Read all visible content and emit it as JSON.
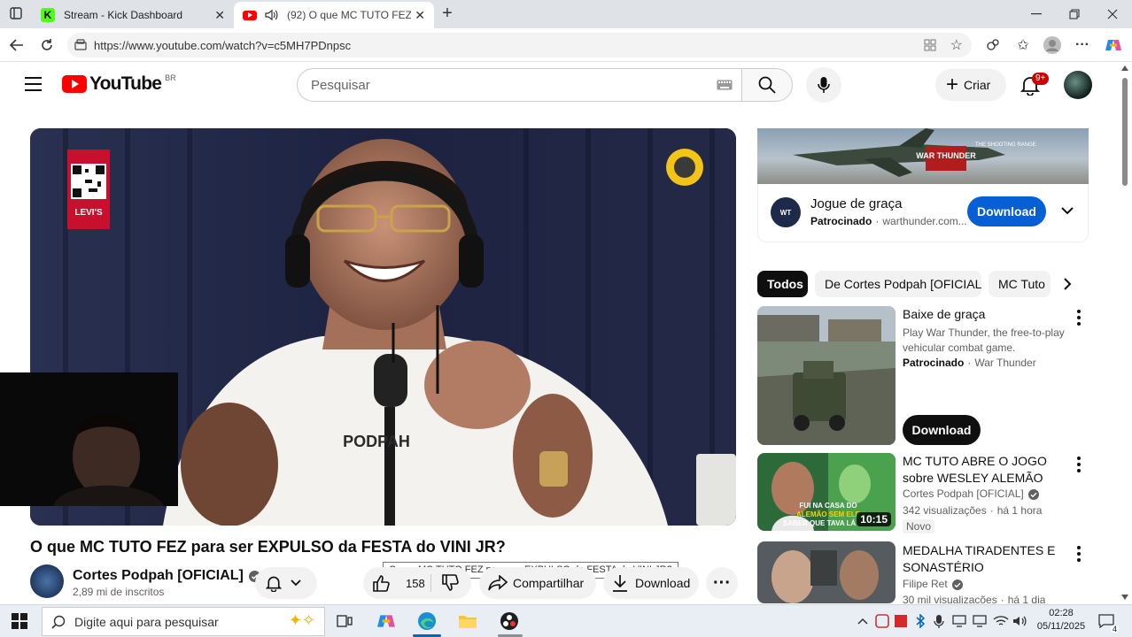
{
  "browser": {
    "tabs": [
      {
        "title": "Stream - Kick Dashboard",
        "active": false
      },
      {
        "title": "(92) O que MC TUTO FEZ par",
        "active": true
      }
    ],
    "url": "https://www.youtube.com/watch?v=c5MH7PDnpsc"
  },
  "youtube": {
    "logo_text": "YouTube",
    "region": "BR",
    "search_placeholder": "Pesquisar",
    "create_label": "Criar",
    "notifications_badge": "9+"
  },
  "video": {
    "title": "O que MC TUTO FEZ para ser EXPULSO da FESTA do VINI JR?",
    "tooltip": "O que MC TUTO FEZ para ser EXPULSO da FESTA do VINI JR?",
    "overlay_brand": "Levi's",
    "shirt_text": "PODPAH",
    "channel": {
      "name": "Cortes Podpah [OFICIAL]",
      "subscribers": "2,89 mi de inscritos"
    },
    "likes": "158",
    "share_label": "Compartilhar",
    "download_label": "Download"
  },
  "ad": {
    "banner_text": "WAR THUNDER",
    "banner_sub": "THE SHOOTING RANGE",
    "title": "Jogue de graça",
    "sponsored": "Patrocinado",
    "domain": "warthunder.com...",
    "cta": "Download"
  },
  "chips": [
    "Todos",
    "De Cortes Podpah [OFICIAL]",
    "MC Tuto"
  ],
  "recommendations": [
    {
      "title": "Baixe de graça",
      "desc": "Play War Thunder, the free-to-play vehicular combat game.",
      "sponsored": "Patrocinado",
      "advertiser": "War Thunder",
      "cta": "Download"
    },
    {
      "title": "MC TUTO ABRE O JOGO sobre WESLEY ALEMÃO",
      "channel": "Cortes Podpah [OFICIAL]",
      "views": "342 visualizações",
      "age": "há 1 hora",
      "badge": "Novo",
      "duration": "10:15",
      "thumb_text": "FUI NA CASA DO ALEMÃO SEM ELE SABER QUE TAVA LÁ"
    },
    {
      "title": "MEDALHA TIRADENTES E SONASTÉRIO",
      "channel": "Filipe Ret",
      "views": "30 mil visualizações",
      "age": "há 1 dia"
    }
  ],
  "taskbar": {
    "search_placeholder": "Digite aqui para pesquisar",
    "time": "02:28",
    "date": "05/11/2025",
    "notifications": "4"
  }
}
